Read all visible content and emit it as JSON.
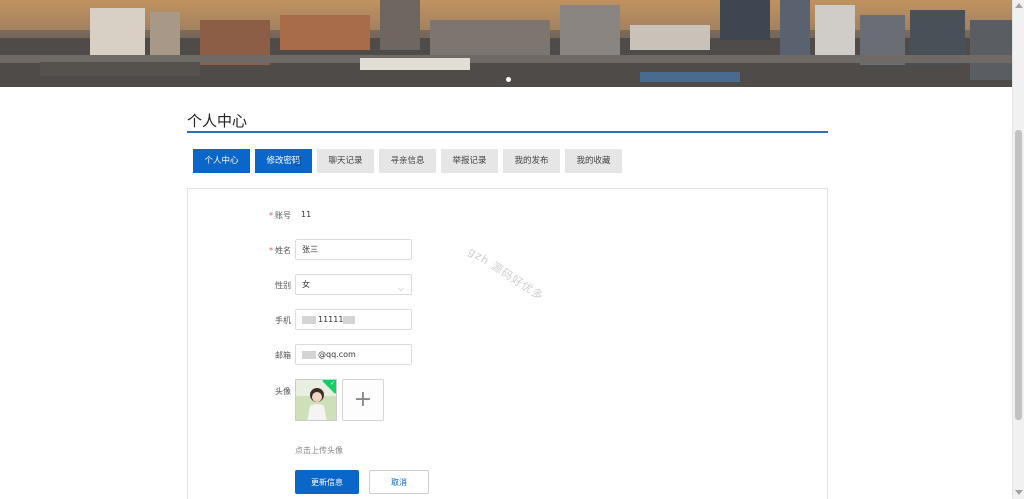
{
  "banner": {
    "alt": "city skyline banner",
    "active_slide": 1
  },
  "page_title": "个人中心",
  "tabs": [
    {
      "label": "个人中心",
      "active": true
    },
    {
      "label": "修改密码",
      "active": false
    },
    {
      "label": "聊天记录",
      "active": false
    },
    {
      "label": "寻亲信息",
      "active": false
    },
    {
      "label": "举报记录",
      "active": false
    },
    {
      "label": "我的发布",
      "active": false
    },
    {
      "label": "我的收藏",
      "active": false
    }
  ],
  "form": {
    "account": {
      "label": "账号",
      "value": "11",
      "required": true
    },
    "name": {
      "label": "姓名",
      "value": "张三",
      "required": true
    },
    "gender": {
      "label": "性别",
      "value": "女"
    },
    "phone": {
      "label": "手机",
      "value": "11111"
    },
    "email": {
      "label": "邮箱",
      "value": "@qq.com"
    },
    "avatar": {
      "label": "头像",
      "upload_icon": "plus-icon"
    },
    "upload_hint": "点击上传头像",
    "submit_label": "更新信息",
    "cancel_label": "取消"
  },
  "watermark": "gzh 源码好优多",
  "colors": {
    "accent": "#0a66c9",
    "rule": "#2f6fb8",
    "success": "#13ce66"
  }
}
